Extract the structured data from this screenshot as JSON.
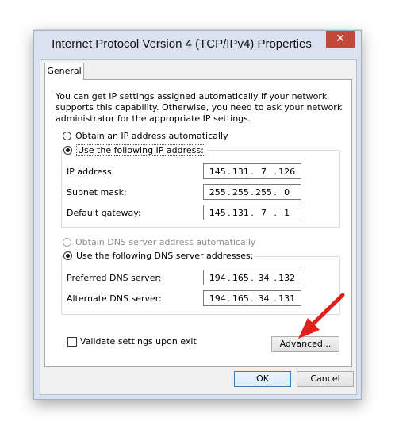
{
  "window": {
    "title": "Internet Protocol Version 4 (TCP/IPv4) Properties",
    "close_glyph": "✕"
  },
  "tab": {
    "label": "General"
  },
  "description": "You can get IP settings assigned automatically if your network supports this capability. Otherwise, you need to ask your network administrator for the appropriate IP settings.",
  "ip_mode": {
    "auto_label": "Obtain an IP address automatically",
    "manual_label": "Use the following IP address:",
    "selected": "manual"
  },
  "ip_fields": [
    {
      "label": "IP address:",
      "octets": [
        "145",
        "131",
        "7",
        "126"
      ]
    },
    {
      "label": "Subnet mask:",
      "octets": [
        "255",
        "255",
        "255",
        "0"
      ]
    },
    {
      "label": "Default gateway:",
      "octets": [
        "145",
        "131",
        "7",
        "1"
      ]
    }
  ],
  "dns_mode": {
    "auto_label": "Obtain DNS server address automatically",
    "manual_label": "Use the following DNS server addresses:",
    "selected": "manual"
  },
  "dns_fields": [
    {
      "label": "Preferred DNS server:",
      "octets": [
        "194",
        "165",
        "34",
        "132"
      ]
    },
    {
      "label": "Alternate DNS server:",
      "octets": [
        "194",
        "165",
        "34",
        "131"
      ]
    }
  ],
  "validate": {
    "label": "Validate settings upon exit",
    "checked": false
  },
  "buttons": {
    "advanced": "Advanced...",
    "ok": "OK",
    "cancel": "Cancel"
  },
  "colors": {
    "arrow": "#e0201a",
    "close": "#c7463a",
    "ok_border": "#3c7fb1"
  }
}
